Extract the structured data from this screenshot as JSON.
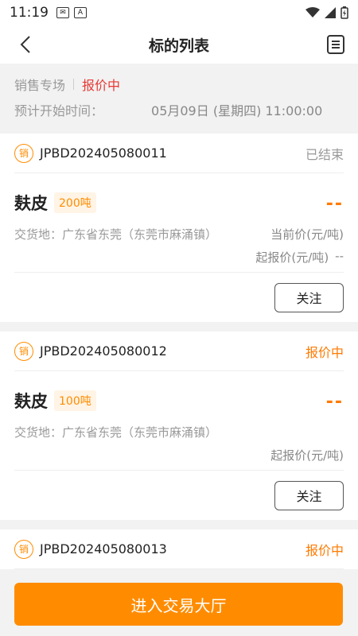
{
  "status_bar": {
    "time": "11:19",
    "icon2_text": "A"
  },
  "navbar": {
    "title": "标的列表"
  },
  "info": {
    "category": "销售专场",
    "status": "报价中",
    "start_label": "预计开始时间：",
    "start_value": "05月09日 (星期四) 11:00:00"
  },
  "cards": [
    {
      "badge": "销",
      "id": "JPBD202405080011",
      "status": "已结束",
      "product": "麸皮",
      "quantity": "200吨",
      "price": "--",
      "location": "交货地：广东省东莞（东莞市麻涌镇）",
      "current_price_label": "当前价(元/吨)",
      "start_price_label": "起报价(元/吨)",
      "start_price_value": "--",
      "follow_label": "关注"
    },
    {
      "badge": "销",
      "id": "JPBD202405080012",
      "status": "报价中",
      "product": "麸皮",
      "quantity": "100吨",
      "price": "--",
      "location": "交货地：广东省东莞（东莞市麻涌镇）",
      "start_price_label": "起报价(元/吨)",
      "follow_label": "关注"
    },
    {
      "badge": "销",
      "id": "JPBD202405080013",
      "status": "报价中"
    }
  ],
  "footer": {
    "enter_label": "进入交易大厅"
  },
  "colors": {
    "accent": "#ff8c00",
    "active_status": "#ff7a00",
    "red_status": "#e53935"
  }
}
